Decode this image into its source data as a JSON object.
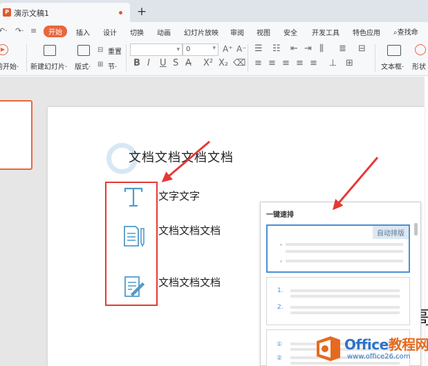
{
  "tab": {
    "app_icon": "P",
    "title": "演示文稿1",
    "new_tab": "+"
  },
  "quick_access": {
    "undo": "↶·",
    "redo": "↷·",
    "more": "≡"
  },
  "menu": [
    {
      "label": "开始",
      "active": true
    },
    {
      "label": "插入"
    },
    {
      "label": "设计"
    },
    {
      "label": "切换"
    },
    {
      "label": "动画"
    },
    {
      "label": "幻灯片放映"
    },
    {
      "label": "审阅"
    },
    {
      "label": "视图"
    },
    {
      "label": "安全"
    },
    {
      "label": "开发工具"
    },
    {
      "label": "特色应用"
    }
  ],
  "search": {
    "label": "查找命"
  },
  "toolbar": {
    "from_start": "前开始·",
    "new_slide": "新建幻灯片·",
    "layout": "版式·",
    "reset": "重置",
    "section": "节·",
    "font_size": "0",
    "textbox": "文本框·",
    "shape": "形状"
  },
  "slide": {
    "title": "文档文档文档文档",
    "item1": "文字文字",
    "item2": "文档文档文档",
    "item3": "文档文档文档",
    "edge_char_top": "(",
    "edge_char_bottom": "哥"
  },
  "panel": {
    "title": "一键速排",
    "badge": "自动排版",
    "list_numbers": [
      "1.",
      "2."
    ],
    "circle_numbers": [
      "①",
      "②"
    ]
  },
  "watermark": {
    "name_part1": "Office",
    "name_part2": "教程网",
    "url": "www.office26.com"
  },
  "colors": {
    "accent": "#e9663e",
    "highlight_box": "#e53935",
    "selection": "#4b8fd6",
    "watermark_blue": "#2b74c9",
    "watermark_orange": "#e56a1f"
  },
  "icons": {
    "text_icon": "text-t-icon",
    "document_icon": "document-pen-icon",
    "sign_icon": "document-sign-icon"
  }
}
